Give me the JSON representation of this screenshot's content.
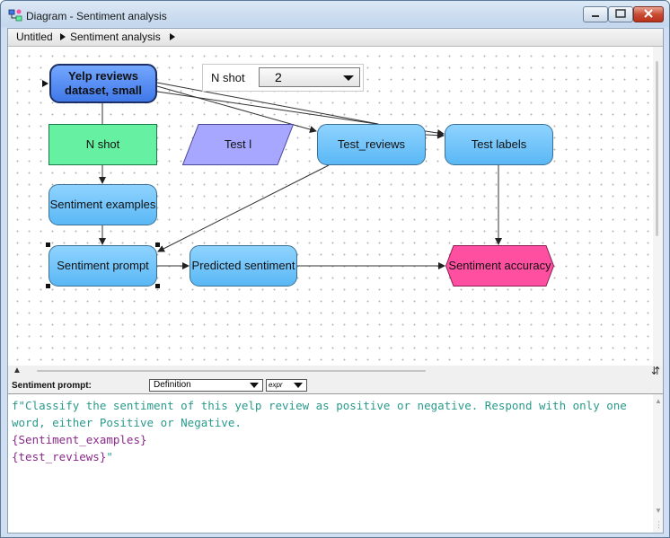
{
  "window": {
    "title": "Diagram - Sentiment analysis",
    "icon": "diagram-app-icon",
    "controls": [
      "minimize-icon",
      "maximize-icon",
      "close-icon"
    ]
  },
  "breadcrumb": [
    "Untitled",
    "Sentiment analysis"
  ],
  "nshot_control": {
    "label": "N shot",
    "value": "2"
  },
  "nodes": {
    "yelp": "Yelp reviews dataset, small",
    "nshot": "N shot",
    "test_l": "Test l",
    "test_reviews": "Test_reviews",
    "test_labels": "Test labels",
    "examples": "Sentiment examples",
    "prompt": "Sentiment prompt",
    "predicted": "Predicted sentiment",
    "accuracy": "Sentiment accuracy"
  },
  "definition": {
    "title": "Sentiment prompt:",
    "view": "Definition",
    "mode": "expr",
    "code": {
      "line1": "f\"Classify the sentiment of this yelp review as positive or negative. Respond with only one",
      "line2": "word, either Positive or Negative.",
      "line3": "{Sentiment_examples}",
      "line4a": "{test_reviews}",
      "line4b": "\""
    }
  },
  "colors": {
    "dataset_node": "#3f78e8",
    "decision_node": "#66f0a2",
    "variable_node": "#5ab8f5",
    "input_node": "#a7a7ff",
    "objective_node": "#ff4fa0",
    "code_text": "#2a9a8c",
    "code_variable": "#8a2a8a"
  }
}
